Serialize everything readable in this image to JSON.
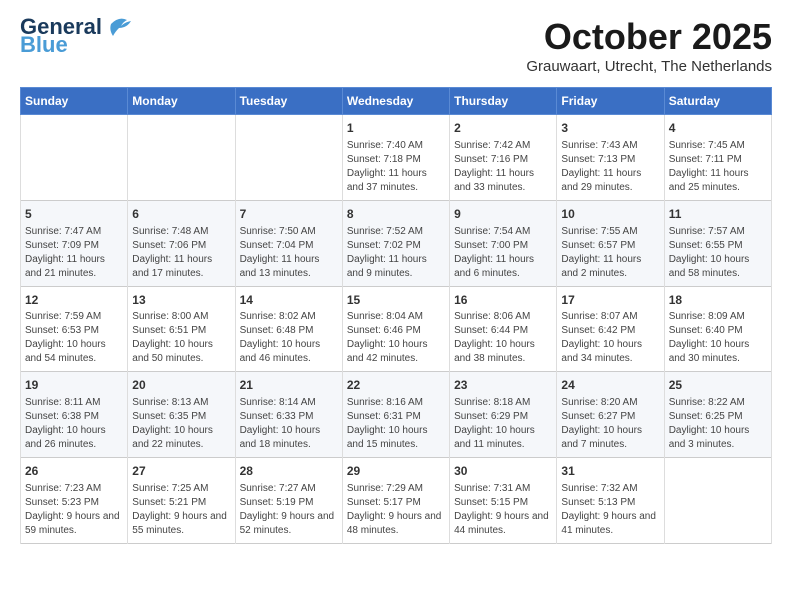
{
  "header": {
    "logo_general": "General",
    "logo_blue": "Blue",
    "month_title": "October 2025",
    "subtitle": "Grauwaart, Utrecht, The Netherlands"
  },
  "columns": [
    "Sunday",
    "Monday",
    "Tuesday",
    "Wednesday",
    "Thursday",
    "Friday",
    "Saturday"
  ],
  "rows": [
    [
      {
        "day": "",
        "info": ""
      },
      {
        "day": "",
        "info": ""
      },
      {
        "day": "",
        "info": ""
      },
      {
        "day": "1",
        "info": "Sunrise: 7:40 AM\nSunset: 7:18 PM\nDaylight: 11 hours and 37 minutes."
      },
      {
        "day": "2",
        "info": "Sunrise: 7:42 AM\nSunset: 7:16 PM\nDaylight: 11 hours and 33 minutes."
      },
      {
        "day": "3",
        "info": "Sunrise: 7:43 AM\nSunset: 7:13 PM\nDaylight: 11 hours and 29 minutes."
      },
      {
        "day": "4",
        "info": "Sunrise: 7:45 AM\nSunset: 7:11 PM\nDaylight: 11 hours and 25 minutes."
      }
    ],
    [
      {
        "day": "5",
        "info": "Sunrise: 7:47 AM\nSunset: 7:09 PM\nDaylight: 11 hours and 21 minutes."
      },
      {
        "day": "6",
        "info": "Sunrise: 7:48 AM\nSunset: 7:06 PM\nDaylight: 11 hours and 17 minutes."
      },
      {
        "day": "7",
        "info": "Sunrise: 7:50 AM\nSunset: 7:04 PM\nDaylight: 11 hours and 13 minutes."
      },
      {
        "day": "8",
        "info": "Sunrise: 7:52 AM\nSunset: 7:02 PM\nDaylight: 11 hours and 9 minutes."
      },
      {
        "day": "9",
        "info": "Sunrise: 7:54 AM\nSunset: 7:00 PM\nDaylight: 11 hours and 6 minutes."
      },
      {
        "day": "10",
        "info": "Sunrise: 7:55 AM\nSunset: 6:57 PM\nDaylight: 11 hours and 2 minutes."
      },
      {
        "day": "11",
        "info": "Sunrise: 7:57 AM\nSunset: 6:55 PM\nDaylight: 10 hours and 58 minutes."
      }
    ],
    [
      {
        "day": "12",
        "info": "Sunrise: 7:59 AM\nSunset: 6:53 PM\nDaylight: 10 hours and 54 minutes."
      },
      {
        "day": "13",
        "info": "Sunrise: 8:00 AM\nSunset: 6:51 PM\nDaylight: 10 hours and 50 minutes."
      },
      {
        "day": "14",
        "info": "Sunrise: 8:02 AM\nSunset: 6:48 PM\nDaylight: 10 hours and 46 minutes."
      },
      {
        "day": "15",
        "info": "Sunrise: 8:04 AM\nSunset: 6:46 PM\nDaylight: 10 hours and 42 minutes."
      },
      {
        "day": "16",
        "info": "Sunrise: 8:06 AM\nSunset: 6:44 PM\nDaylight: 10 hours and 38 minutes."
      },
      {
        "day": "17",
        "info": "Sunrise: 8:07 AM\nSunset: 6:42 PM\nDaylight: 10 hours and 34 minutes."
      },
      {
        "day": "18",
        "info": "Sunrise: 8:09 AM\nSunset: 6:40 PM\nDaylight: 10 hours and 30 minutes."
      }
    ],
    [
      {
        "day": "19",
        "info": "Sunrise: 8:11 AM\nSunset: 6:38 PM\nDaylight: 10 hours and 26 minutes."
      },
      {
        "day": "20",
        "info": "Sunrise: 8:13 AM\nSunset: 6:35 PM\nDaylight: 10 hours and 22 minutes."
      },
      {
        "day": "21",
        "info": "Sunrise: 8:14 AM\nSunset: 6:33 PM\nDaylight: 10 hours and 18 minutes."
      },
      {
        "day": "22",
        "info": "Sunrise: 8:16 AM\nSunset: 6:31 PM\nDaylight: 10 hours and 15 minutes."
      },
      {
        "day": "23",
        "info": "Sunrise: 8:18 AM\nSunset: 6:29 PM\nDaylight: 10 hours and 11 minutes."
      },
      {
        "day": "24",
        "info": "Sunrise: 8:20 AM\nSunset: 6:27 PM\nDaylight: 10 hours and 7 minutes."
      },
      {
        "day": "25",
        "info": "Sunrise: 8:22 AM\nSunset: 6:25 PM\nDaylight: 10 hours and 3 minutes."
      }
    ],
    [
      {
        "day": "26",
        "info": "Sunrise: 7:23 AM\nSunset: 5:23 PM\nDaylight: 9 hours and 59 minutes."
      },
      {
        "day": "27",
        "info": "Sunrise: 7:25 AM\nSunset: 5:21 PM\nDaylight: 9 hours and 55 minutes."
      },
      {
        "day": "28",
        "info": "Sunrise: 7:27 AM\nSunset: 5:19 PM\nDaylight: 9 hours and 52 minutes."
      },
      {
        "day": "29",
        "info": "Sunrise: 7:29 AM\nSunset: 5:17 PM\nDaylight: 9 hours and 48 minutes."
      },
      {
        "day": "30",
        "info": "Sunrise: 7:31 AM\nSunset: 5:15 PM\nDaylight: 9 hours and 44 minutes."
      },
      {
        "day": "31",
        "info": "Sunrise: 7:32 AM\nSunset: 5:13 PM\nDaylight: 9 hours and 41 minutes."
      },
      {
        "day": "",
        "info": ""
      }
    ]
  ]
}
